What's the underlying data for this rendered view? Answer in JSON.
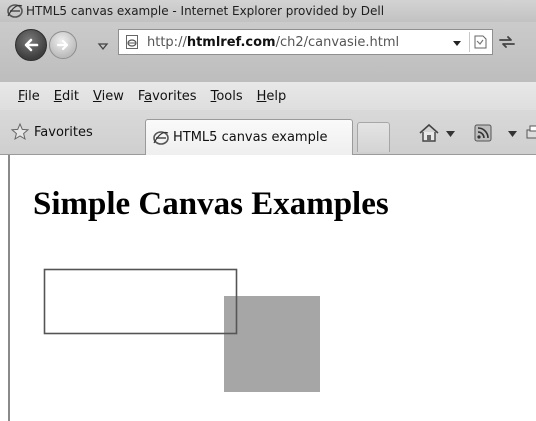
{
  "window": {
    "title": "HTML5 canvas example - Internet Explorer provided by Dell"
  },
  "address": {
    "url_prefix": "http://",
    "url_domain": "htmlref.com",
    "url_path": "/ch2/canvasie.html"
  },
  "menu": {
    "items": [
      {
        "underline": "F",
        "rest": "ile"
      },
      {
        "underline": "E",
        "rest": "dit"
      },
      {
        "underline": "V",
        "rest": "iew"
      },
      {
        "pre": "F",
        "underline": "a",
        "rest": "vorites"
      },
      {
        "underline": "T",
        "rest": "ools"
      },
      {
        "underline": "H",
        "rest": "elp"
      }
    ]
  },
  "toolbar": {
    "favorites_label": "Favorites"
  },
  "tabs": [
    {
      "label": "HTML5 canvas example",
      "active": true
    }
  ],
  "page": {
    "heading": "Simple Canvas Examples"
  },
  "colors": {
    "filled_square": "#a6a6a6",
    "outline_rect": "#555555"
  },
  "icons": [
    "ie-icon",
    "back-arrow-icon",
    "forward-arrow-icon",
    "page-icon",
    "compatibility-icon",
    "refresh-icon",
    "favorites-star-icon",
    "home-icon",
    "feeds-icon",
    "print-icon"
  ]
}
